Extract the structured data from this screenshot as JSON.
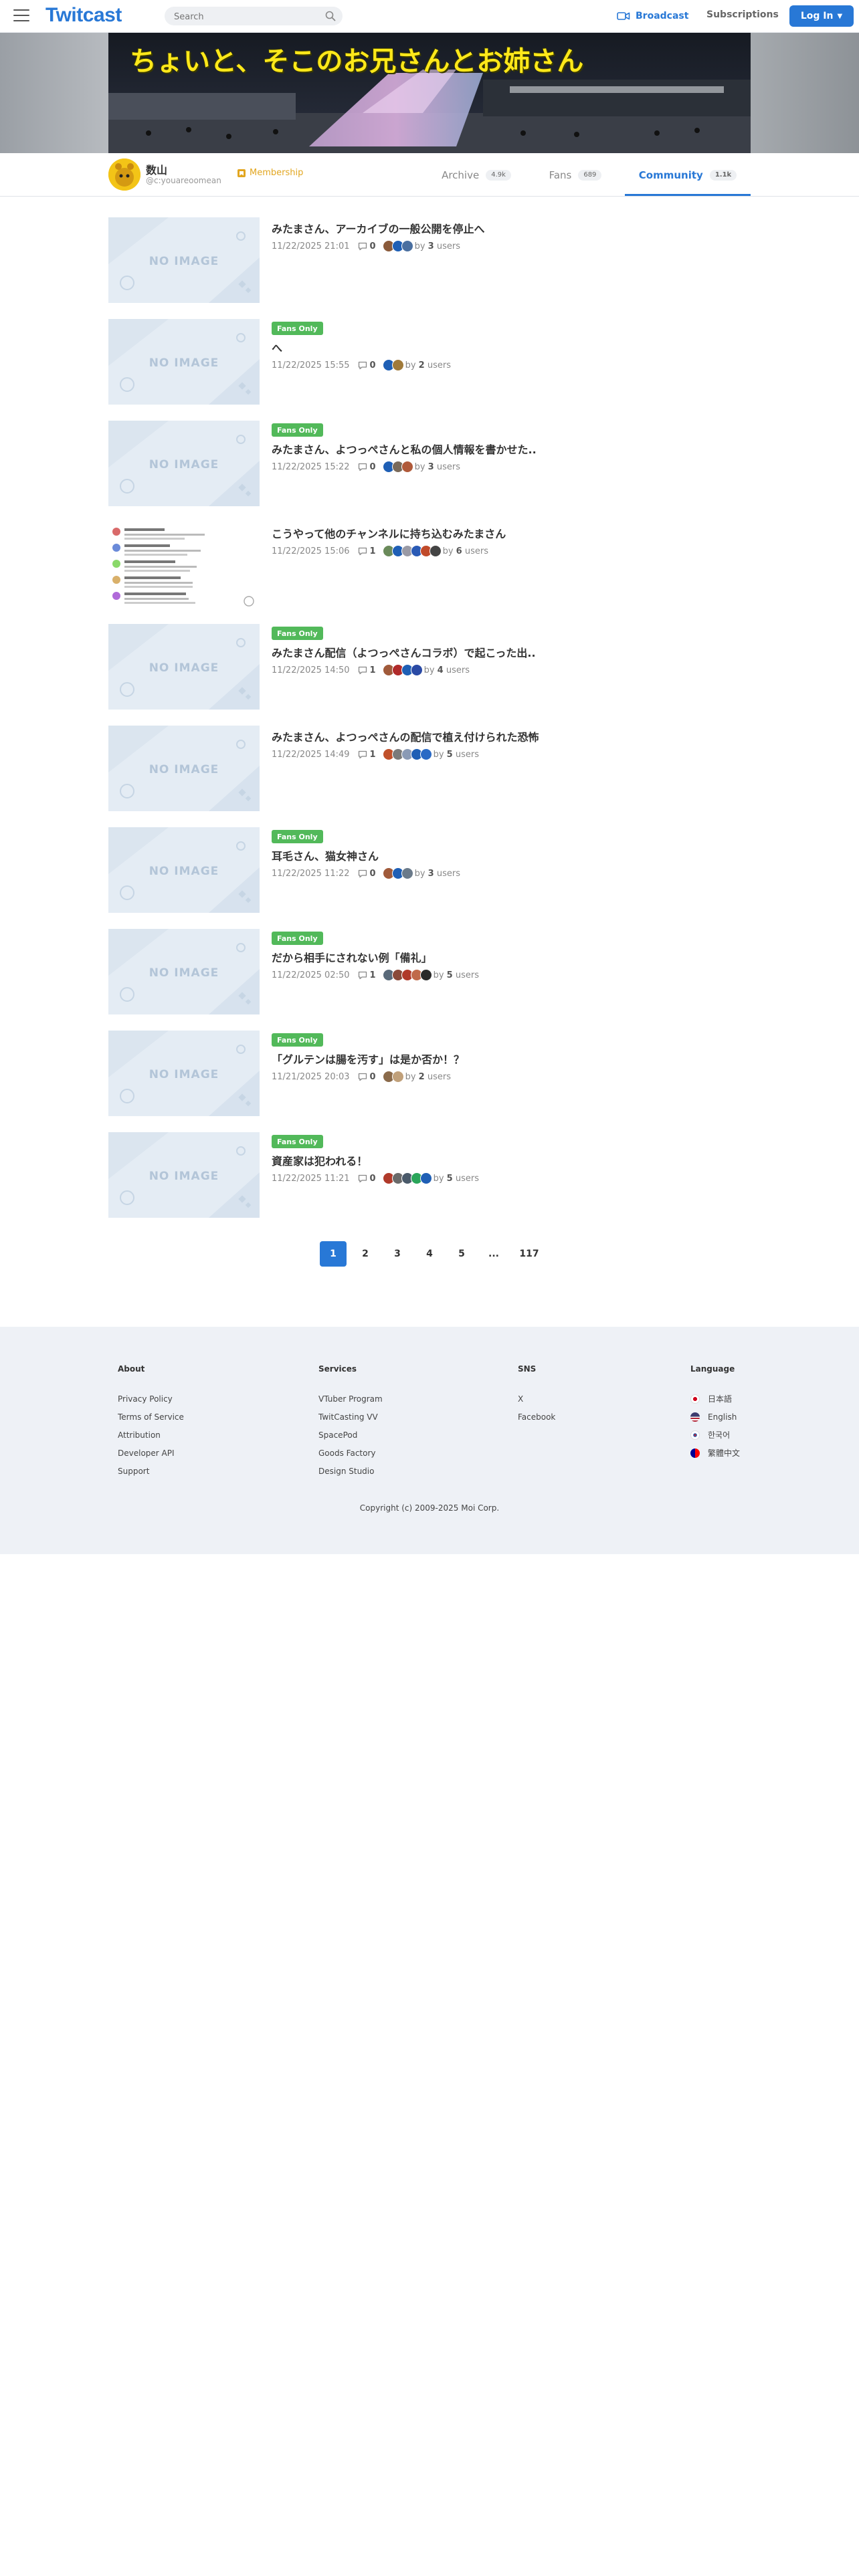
{
  "header": {
    "logo": "Twitcast",
    "search_placeholder": "Search",
    "broadcast": "Broadcast",
    "subscriptions": "Subscriptions",
    "login": "Log In"
  },
  "banner": {
    "title": "ちょいと、そこのお兄さんとお姉さん"
  },
  "profile": {
    "name": "数山",
    "handle": "@c:youareoomean",
    "membership": "Membership",
    "tabs": [
      {
        "label": "Archive",
        "count": "4.9k"
      },
      {
        "label": "Fans",
        "count": "689"
      },
      {
        "label": "Community",
        "count": "1.1k"
      }
    ]
  },
  "posts": [
    {
      "badge": "",
      "title": "みたまさん、アーカイブの一般公開を停止へ",
      "date": "11/22/2025 21:01",
      "comments": "0",
      "users": "3",
      "thumb": "NO IMAGE"
    },
    {
      "badge": "Fans Only",
      "title": "へ",
      "date": "11/22/2025 15:55",
      "comments": "0",
      "users": "2",
      "thumb": "NO IMAGE"
    },
    {
      "badge": "Fans Only",
      "title": "みたまさん、よつっぺさんと私の個人情報を書かせた..",
      "date": "11/22/2025 15:22",
      "comments": "0",
      "users": "3",
      "thumb": "NO IMAGE"
    },
    {
      "badge": "",
      "title": "こうやって他のチャンネルに持ち込むみたまさん",
      "date": "11/22/2025 15:06",
      "comments": "1",
      "users": "6",
      "thumb": ""
    },
    {
      "badge": "Fans Only",
      "title": "みたまさん配信（よつっぺさんコラボ）で起こった出..",
      "date": "11/22/2025 14:50",
      "comments": "1",
      "users": "4",
      "thumb": "NO IMAGE"
    },
    {
      "badge": "",
      "title": "みたまさん、よつっぺさんの配信で植え付けられた恐怖",
      "date": "11/22/2025 14:49",
      "comments": "1",
      "users": "5",
      "thumb": "NO IMAGE"
    },
    {
      "badge": "Fans Only",
      "title": "耳毛さん、猫女神さん",
      "date": "11/22/2025 11:22",
      "comments": "0",
      "users": "3",
      "thumb": "NO IMAGE"
    },
    {
      "badge": "Fans Only",
      "title": "だから相手にされない例「備礼」",
      "date": "11/22/2025 02:50",
      "comments": "1",
      "users": "5",
      "thumb": "NO IMAGE"
    },
    {
      "badge": "Fans Only",
      "title": "「グルテンは腸を汚す」は是か否か！？",
      "date": "11/21/2025 20:03",
      "comments": "0",
      "users": "2",
      "thumb": "NO IMAGE"
    },
    {
      "badge": "Fans Only",
      "title": "資産家は犯われる！",
      "date": "11/22/2025 11:21",
      "comments": "0",
      "users": "5",
      "thumb": "NO IMAGE"
    }
  ],
  "labels": {
    "by": "by",
    "users": "users"
  },
  "pagination": [
    "1",
    "2",
    "3",
    "4",
    "5",
    "...",
    "117"
  ],
  "footer": {
    "about": {
      "title": "About",
      "links": [
        "Privacy Policy",
        "Terms of Service",
        "Attribution",
        "Developer API",
        "Support"
      ]
    },
    "services": {
      "title": "Services",
      "links": [
        "VTuber Program",
        "TwitCasting VV",
        "SpacePod",
        "Goods Factory",
        "Design Studio"
      ]
    },
    "sns": {
      "title": "SNS",
      "links": [
        "X",
        "Facebook"
      ]
    },
    "language": {
      "title": "Language",
      "links": [
        "日本語",
        "English",
        "한국어",
        "繁體中文"
      ]
    },
    "copyright": "Copyright (c) 2009-2025 Moi Corp."
  },
  "colors": {
    "accent": "#2878d6",
    "fans_only": "#52b95a",
    "membership": "#e2a620",
    "footer_bg": "#eef1f6"
  }
}
